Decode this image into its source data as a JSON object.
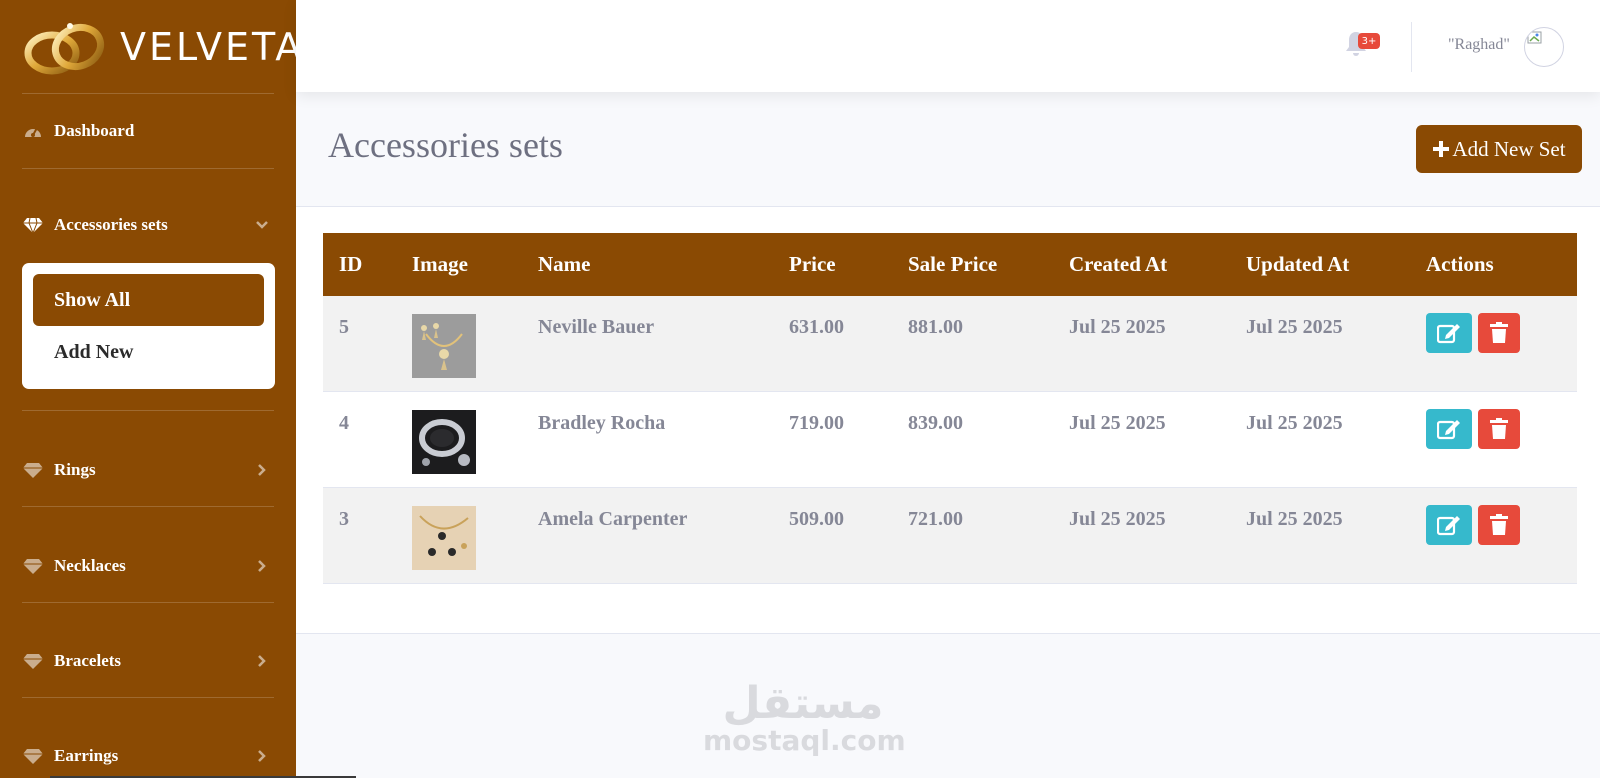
{
  "brand": {
    "name": "VELVETA"
  },
  "sidebar": {
    "items": [
      {
        "label": "Dashboard",
        "icon": "gauge-icon"
      },
      {
        "label": "Accessories sets",
        "icon": "diamond-icon",
        "expanded": true,
        "submenu": [
          {
            "label": "Show All",
            "active": true
          },
          {
            "label": "Add New"
          }
        ]
      },
      {
        "label": "Rings",
        "icon": "diamond-icon"
      },
      {
        "label": "Necklaces",
        "icon": "diamond-icon"
      },
      {
        "label": "Bracelets",
        "icon": "diamond-icon"
      },
      {
        "label": "Earrings",
        "icon": "diamond-icon"
      }
    ]
  },
  "topbar": {
    "notification_count": "3+",
    "user_name": "\"Raghad\""
  },
  "page": {
    "title": "Accessories sets",
    "add_button_label": "Add New Set"
  },
  "table": {
    "columns": [
      "ID",
      "Image",
      "Name",
      "Price",
      "Sale Price",
      "Created At",
      "Updated At",
      "Actions"
    ],
    "rows": [
      {
        "id": "5",
        "name": "Neville Bauer",
        "price": "631.00",
        "sale_price": "881.00",
        "created_at": "Jul 25 2025",
        "updated_at": "Jul 25 2025"
      },
      {
        "id": "4",
        "name": "Bradley Rocha",
        "price": "719.00",
        "sale_price": "839.00",
        "created_at": "Jul 25 2025",
        "updated_at": "Jul 25 2025"
      },
      {
        "id": "3",
        "name": "Amela Carpenter",
        "price": "509.00",
        "sale_price": "721.00",
        "created_at": "Jul 25 2025",
        "updated_at": "Jul 25 2025"
      }
    ]
  },
  "watermark": {
    "arabic": "مستقل",
    "latin": "mostaql.com"
  },
  "colors": {
    "brand": "#8a4a03",
    "edit": "#36b9cc",
    "delete": "#e74a3b",
    "badge": "#e74a3b"
  }
}
